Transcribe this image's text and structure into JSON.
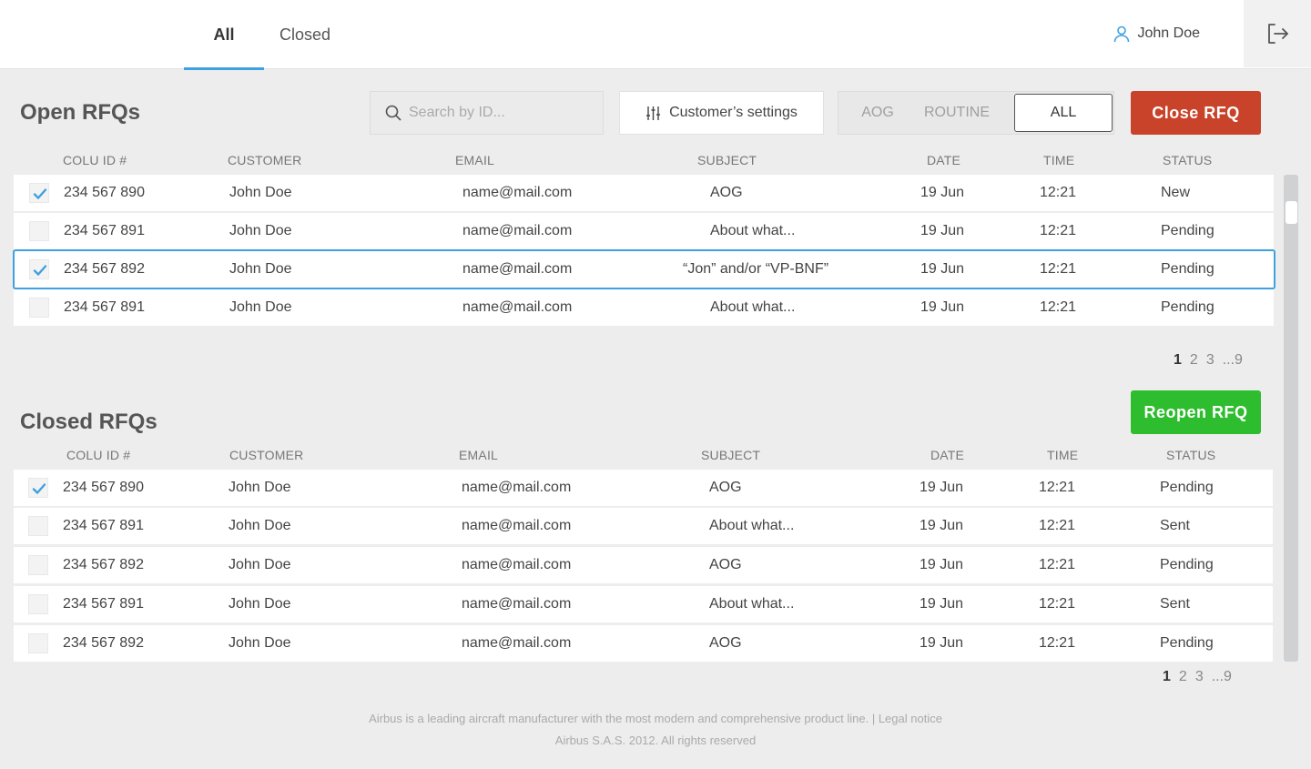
{
  "tabs": [
    {
      "label": "All"
    },
    {
      "label": "Closed"
    }
  ],
  "user": {
    "name": "John Doe"
  },
  "open": {
    "title": "Open RFQs",
    "search_placeholder": "Search by ID...",
    "settings_label": "Customer’s settings",
    "filters": [
      "AOG",
      "ROUTINE",
      "ALL"
    ],
    "active_filter": "ALL",
    "action_label": "Close RFQ",
    "columns": [
      "COLU ID #",
      "CUSTOMER",
      "EMAIL",
      "SUBJECT",
      "DATE",
      "TIME",
      "STATUS"
    ],
    "rows": [
      {
        "id": "234 567 890",
        "customer": "John Doe",
        "email": "name@mail.com",
        "subject": "AOG",
        "date": "19 Jun",
        "time": "12:21",
        "status": "New",
        "checked": true
      },
      {
        "id": "234 567 891",
        "customer": "John Doe",
        "email": "name@mail.com",
        "subject": "About what...",
        "date": "19 Jun",
        "time": "12:21",
        "status": "Pending",
        "checked": false
      },
      {
        "id": "234 567 892",
        "customer": "John Doe",
        "email": "name@mail.com",
        "subject": "“Jon” and/or “VP-BNF”",
        "date": "19 Jun",
        "time": "12:21",
        "status": "Pending",
        "checked": true
      },
      {
        "id": "234 567 891",
        "customer": "John Doe",
        "email": "name@mail.com",
        "subject": "About what...",
        "date": "19 Jun",
        "time": "12:21",
        "status": "Pending",
        "checked": false
      }
    ],
    "pager": [
      "1",
      "2",
      "3",
      "...9"
    ]
  },
  "closed": {
    "title": "Closed RFQs",
    "action_label": "Reopen RFQ",
    "columns": [
      "COLU ID #",
      "CUSTOMER",
      "EMAIL",
      "SUBJECT",
      "DATE",
      "TIME",
      "STATUS"
    ],
    "rows": [
      {
        "id": "234 567 890",
        "customer": "John Doe",
        "email": "name@mail.com",
        "subject": "AOG",
        "date": "19 Jun",
        "time": "12:21",
        "status": "Pending",
        "checked": true
      },
      {
        "id": "234 567 891",
        "customer": "John Doe",
        "email": "name@mail.com",
        "subject": "About what...",
        "date": "19 Jun",
        "time": "12:21",
        "status": "Sent",
        "checked": false
      },
      {
        "id": "234 567 892",
        "customer": "John Doe",
        "email": "name@mail.com",
        "subject": "AOG",
        "date": "19 Jun",
        "time": "12:21",
        "status": "Pending",
        "checked": false
      },
      {
        "id": "234 567 891",
        "customer": "John Doe",
        "email": "name@mail.com",
        "subject": "About what...",
        "date": "19 Jun",
        "time": "12:21",
        "status": "Sent",
        "checked": false
      },
      {
        "id": "234 567 892",
        "customer": "John Doe",
        "email": "name@mail.com",
        "subject": "AOG",
        "date": "19 Jun",
        "time": "12:21",
        "status": "Pending",
        "checked": false
      }
    ],
    "pager": [
      "1",
      "2",
      "3",
      "...9"
    ]
  },
  "footer": {
    "line1": "Airbus is a leading aircraft manufacturer with the most modern and comprehensive product line. | Legal notice",
    "line2": "Airbus S.A.S. 2012. All rights reserved"
  },
  "colors": {
    "accent": "#3ea1e0",
    "close_button": "#c8432a",
    "reopen_button": "#2ebd2e"
  },
  "icons": {
    "user": "user-icon",
    "logout": "logout-icon",
    "search": "search-icon",
    "settings": "sliders-icon",
    "check": "checkmark-icon"
  }
}
